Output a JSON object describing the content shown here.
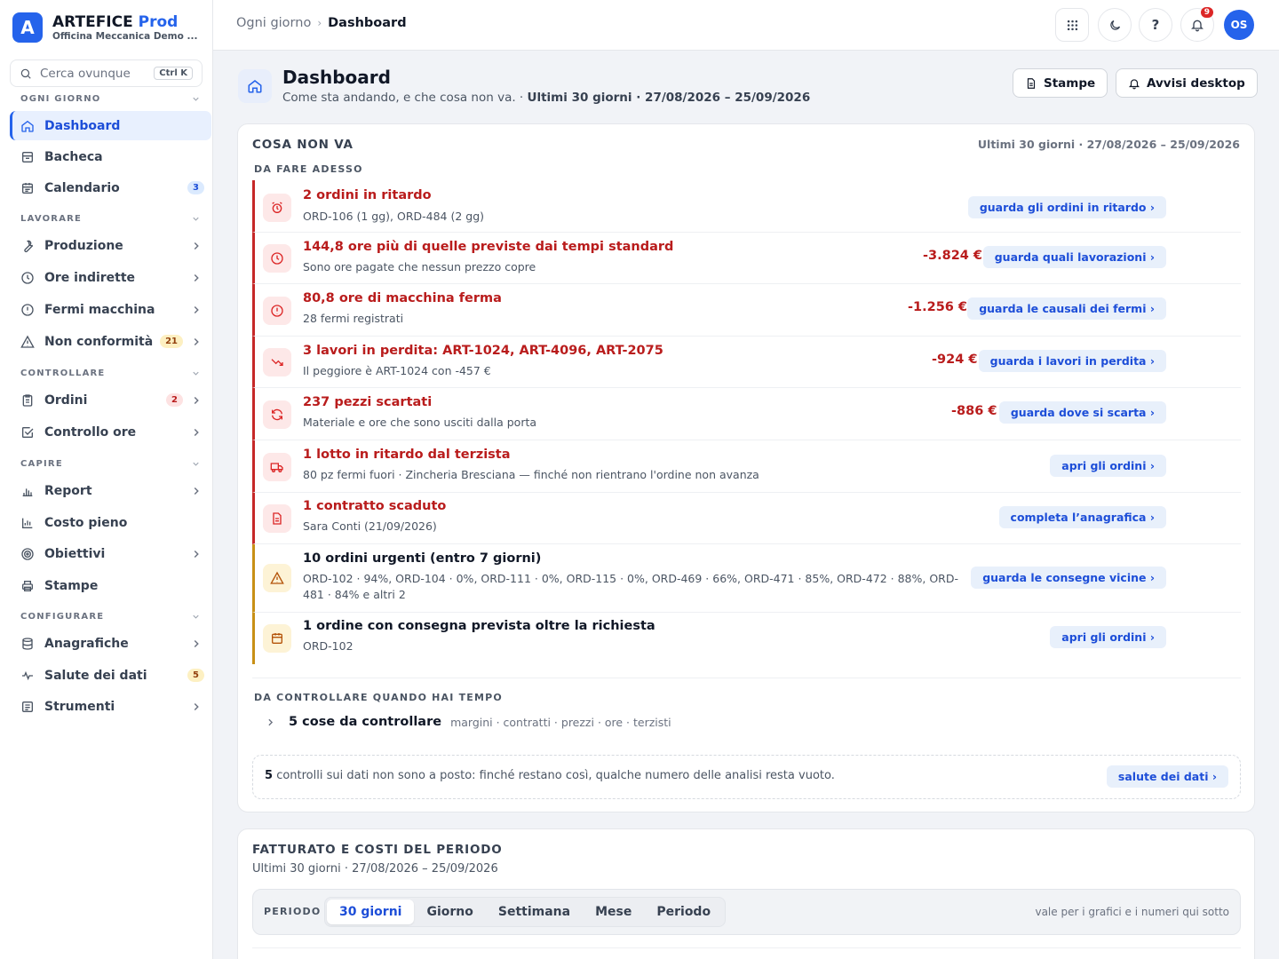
{
  "brand": {
    "logo_letter": "A",
    "name": "ARTEFICE",
    "name_accent": "Prod",
    "org": "Officina Meccanica Demo ..."
  },
  "search": {
    "placeholder": "Cerca ovunque",
    "shortcut": "Ctrl K"
  },
  "sidebar": {
    "sections": [
      "OGNI GIORNO",
      "LAVORARE",
      "CONTROLLARE",
      "CAPIRE",
      "CONFIGURARE"
    ],
    "items": [
      {
        "label": "Dashboard",
        "icon": "home-icon"
      },
      {
        "label": "Bacheca",
        "icon": "board-icon"
      },
      {
        "label": "Calendario",
        "icon": "calendar-icon",
        "badge": "3"
      },
      {
        "label": "Produzione",
        "icon": "wrench-icon"
      },
      {
        "label": "Ore indirette",
        "icon": "clock-icon"
      },
      {
        "label": "Fermi macchina",
        "icon": "alert-circle-icon"
      },
      {
        "label": "Non conformità",
        "icon": "warning-icon",
        "badge": "21"
      },
      {
        "label": "Ordini",
        "icon": "clipboard-icon",
        "badge": "2"
      },
      {
        "label": "Controllo ore",
        "icon": "check-square-icon"
      },
      {
        "label": "Report",
        "icon": "bar-chart-icon"
      },
      {
        "label": "Costo pieno",
        "icon": "chart-icon"
      },
      {
        "label": "Obiettivi",
        "icon": "target-icon"
      },
      {
        "label": "Stampe",
        "icon": "printer-icon"
      },
      {
        "label": "Anagrafiche",
        "icon": "database-icon"
      },
      {
        "label": "Salute dei dati",
        "icon": "pulse-icon",
        "badge": "5"
      },
      {
        "label": "Strumenti",
        "icon": "tools-icon"
      }
    ]
  },
  "topbar": {
    "breadcrumb_parent": "Ogni giorno",
    "breadcrumb_current": "Dashboard",
    "notifications_count": "9",
    "avatar_initials": "OS"
  },
  "page": {
    "title": "Dashboard",
    "subtitle": "Come sta andando, e che cosa non va.",
    "subtitle_range": "Ultimi 30 giorni · 27/08/2026 – 25/09/2026",
    "btn_print": "Stampe",
    "btn_alerts": "Avvisi desktop"
  },
  "issues_card": {
    "title": "COSA NON VA",
    "range": "Ultimi 30 giorni · 27/08/2026 – 25/09/2026",
    "now_label": "DA FARE ADESSO",
    "items": [
      {
        "title": "2 ordini in ritardo",
        "desc": "ORD-106 (1 gg), ORD-484 (2 gg)",
        "amount": "",
        "action": "guarda gli ordini in ritardo ›"
      },
      {
        "title": "144,8 ore più di quelle previste dai tempi standard",
        "desc": "Sono ore pagate che nessun prezzo copre",
        "amount": "-3.824 €",
        "action": "guarda quali lavorazioni ›"
      },
      {
        "title": "80,8 ore di macchina ferma",
        "desc": "28 fermi registrati",
        "amount": "-1.256 €",
        "action": "guarda le causali dei fermi ›"
      },
      {
        "title": "3 lavori in perdita: ART-1024, ART-4096, ART-2075",
        "desc": "Il peggiore è ART-1024 con -457 €",
        "amount": "-924 €",
        "action": "guarda i lavori in perdita ›"
      },
      {
        "title": "237 pezzi scartati",
        "desc": "Materiale e ore che sono usciti dalla porta",
        "amount": "-886 €",
        "action": "guarda dove si scarta ›"
      },
      {
        "title": "1 lotto in ritardo dal terzista",
        "desc": "80 pz fermi fuori · Zincheria Bresciana — finché non rientrano l'ordine non avanza",
        "amount": "",
        "action": "apri gli ordini ›"
      },
      {
        "title": "1 contratto scaduto",
        "desc": "Sara Conti (21/09/2026)",
        "amount": "",
        "action": "completa l’anagrafica ›"
      },
      {
        "title": "10 ordini urgenti (entro 7 giorni)",
        "desc": "ORD-102 · 94%, ORD-104 · 0%, ORD-111 · 0%, ORD-115 · 0%, ORD-469 · 66%, ORD-471 · 85%, ORD-472 · 88%, ORD-481 · 84% e altri 2",
        "amount": "",
        "action": "guarda le consegne vicine ›"
      },
      {
        "title": "1 ordine con consegna prevista oltre la richiesta",
        "desc": "ORD-102",
        "amount": "",
        "action": "apri gli ordini ›"
      }
    ],
    "later_label": "DA CONTROLLARE QUANDO HAI TEMPO",
    "later_title": "5 cose da controllare",
    "later_meta": "margini · contratti · prezzi · ore · terzisti",
    "health_count": "5",
    "health_text": "controlli sui dati non sono a posto: finché restano così, qualche numero delle analisi resta vuoto.",
    "health_action": "salute dei dati ›"
  },
  "revenue_card": {
    "title": "FATTURATO E COSTI DEL PERIODO",
    "range": "Ultimi 30 giorni · 27/08/2026 – 25/09/2026",
    "period_label": "PERIODO",
    "periods": [
      "30 giorni",
      "Giorno",
      "Settimana",
      "Mese",
      "Periodo"
    ],
    "note": "vale per i grafici e i numeri qui sotto"
  },
  "colors": {
    "accent": "#2563eb",
    "danger": "#b91c1c",
    "warning": "#c89016"
  }
}
